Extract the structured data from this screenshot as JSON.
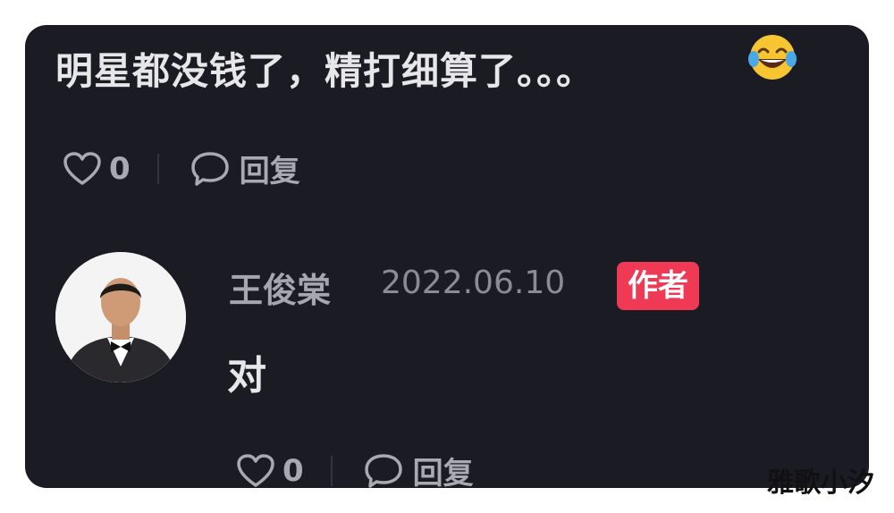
{
  "comment": {
    "text": "明星都没钱了，精打细算了。。。",
    "emoji_icon": "laughing-tears-emoji",
    "likes": "0",
    "reply_label": "回复"
  },
  "reply": {
    "author": "王俊棠",
    "date": "2022.06.10",
    "badge": "作者",
    "text": "对",
    "likes": "0",
    "reply_label": "回复"
  },
  "watermark": "雅歌小汐",
  "colors": {
    "card_background": "#1b1b24",
    "badge": "#f03a55",
    "primary_text": "#e7e7ea",
    "secondary_text": "#a9a9b0"
  }
}
